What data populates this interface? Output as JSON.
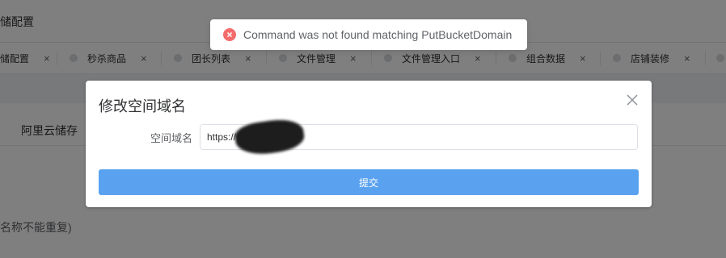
{
  "page": {
    "title": "储配置",
    "sub_tab": "阿里云储存",
    "hint": "名称不能重复)"
  },
  "tabs": [
    {
      "label": "储配置",
      "close": "×"
    },
    {
      "label": "秒杀商品",
      "close": "×"
    },
    {
      "label": "团长列表",
      "close": "×"
    },
    {
      "label": "文件管理",
      "close": "×"
    },
    {
      "label": "文件管理入口",
      "close": "×"
    },
    {
      "label": "组合数据",
      "close": "×"
    },
    {
      "label": "店铺装修",
      "close": "×"
    }
  ],
  "dialog": {
    "title": "修改空间域名",
    "close_icon": "close-icon",
    "field_label": "空间域名",
    "field_value": "https://",
    "submit_label": "提交"
  },
  "toast": {
    "icon": "error-circle-icon",
    "message": "Command was not found matching PutBucketDomain"
  },
  "colors": {
    "primary_button": "#5aa2f0",
    "error": "#f56c6c",
    "overlay": "rgba(0,0,0,0.5)"
  }
}
